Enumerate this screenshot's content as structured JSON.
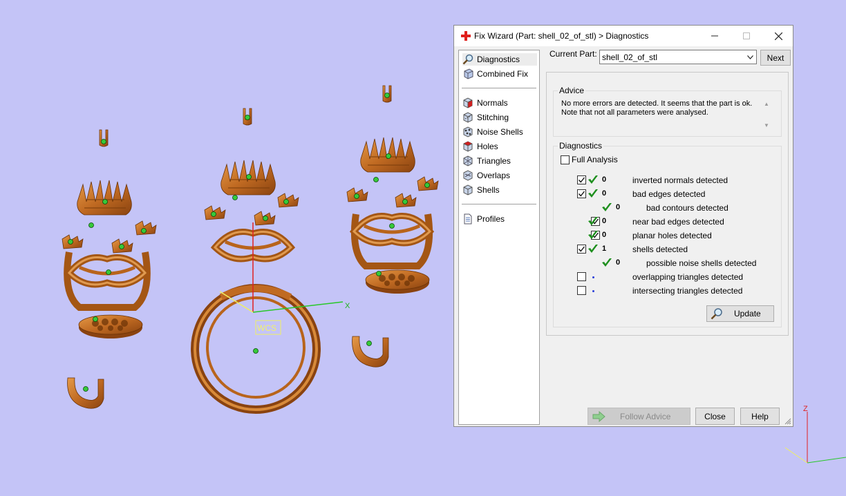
{
  "viewport": {
    "background_color": "#c4c4f7",
    "model_color": "#c8732a",
    "wcs_label": "WCS",
    "main_axis_x_label": "X",
    "corner_axis_z_label": "Z"
  },
  "dialog": {
    "title": "Fix Wizard (Part: shell_02_of_stl) > Diagnostics",
    "title_icon": "red-cross-icon",
    "window_controls": [
      "minimize",
      "maximize",
      "close"
    ],
    "nav": {
      "items": [
        {
          "label": "Diagnostics",
          "icon": "magnifier-icon",
          "selected": true
        },
        {
          "label": "Combined Fix",
          "icon": "combined-fix-icon"
        },
        {
          "label": "Normals",
          "icon": "normals-cube-icon"
        },
        {
          "label": "Stitching",
          "icon": "stitching-icon"
        },
        {
          "label": "Noise Shells",
          "icon": "noise-shells-icon"
        },
        {
          "label": "Holes",
          "icon": "holes-cube-icon"
        },
        {
          "label": "Triangles",
          "icon": "triangles-icon"
        },
        {
          "label": "Overlaps",
          "icon": "overlaps-icon"
        },
        {
          "label": "Shells",
          "icon": "shells-icon"
        },
        {
          "label": "Profiles",
          "icon": "document-icon"
        }
      ]
    },
    "current_part": {
      "label": "Current Part:",
      "value": "shell_02_of_stl",
      "next_button": "Next"
    },
    "advice": {
      "title": "Advice",
      "text_line1": "No more errors are detected. It seems that the part is ok.",
      "text_line2": "Note that not all parameters were analysed."
    },
    "diagnostics": {
      "title": "Diagnostics",
      "full_analysis_label": "Full Analysis",
      "full_analysis_checked": false,
      "rows": [
        {
          "checkbox": true,
          "checked": true,
          "status": "ok",
          "count": "0",
          "label": "inverted normals detected"
        },
        {
          "checkbox": true,
          "checked": true,
          "status": "ok",
          "count": "0",
          "label": "bad edges detected"
        },
        {
          "checkbox": false,
          "status": "ok",
          "count": "0",
          "label": "bad contours detected"
        },
        {
          "checkbox": true,
          "checked": true,
          "status": "ok",
          "count": "0",
          "label": "near bad edges detected"
        },
        {
          "checkbox": true,
          "checked": true,
          "status": "ok",
          "count": "0",
          "label": "planar holes detected"
        },
        {
          "checkbox": true,
          "checked": true,
          "status": "ok",
          "count": "1",
          "label": "shells detected"
        },
        {
          "checkbox": false,
          "status": "ok",
          "count": "0",
          "label": "possible noise shells detected"
        },
        {
          "checkbox": true,
          "checked": false,
          "status": "pending",
          "count": "",
          "label": "overlapping triangles detected"
        },
        {
          "checkbox": true,
          "checked": false,
          "status": "pending",
          "count": "",
          "label": "intersecting triangles detected"
        }
      ],
      "update_button": "Update"
    },
    "footer": {
      "follow_advice": "Follow Advice",
      "close": "Close",
      "help": "Help"
    },
    "colors": {
      "check_green": "#1e8f1e",
      "pending_dot": "#2a3fd8",
      "title_icon_red": "#e0201c"
    }
  }
}
